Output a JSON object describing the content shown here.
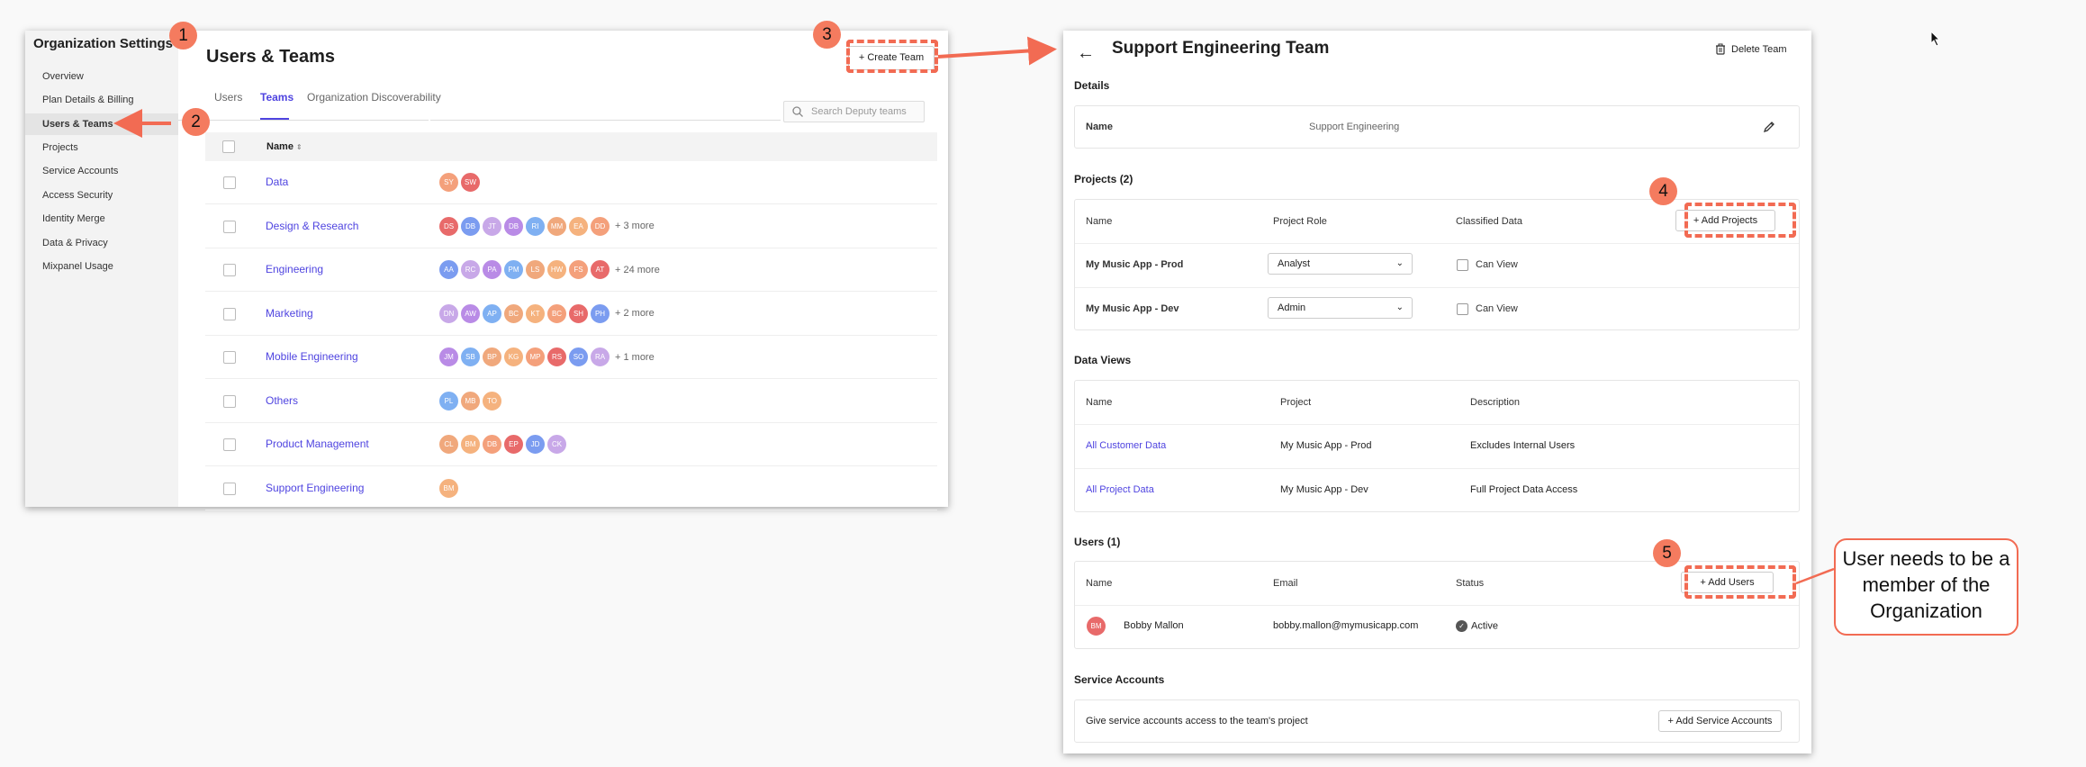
{
  "left_window": {
    "sidebar": {
      "title": "Organization Settings",
      "items": [
        {
          "label": "Overview"
        },
        {
          "label": "Plan Details & Billing"
        },
        {
          "label": "Users & Teams"
        },
        {
          "label": "Projects"
        },
        {
          "label": "Service Accounts"
        },
        {
          "label": "Access Security"
        },
        {
          "label": "Identity Merge"
        },
        {
          "label": "Data & Privacy"
        },
        {
          "label": "Mixpanel Usage"
        }
      ],
      "active_item": "Users & Teams"
    },
    "page_title": "Users & Teams",
    "tabs": [
      {
        "label": "Users"
      },
      {
        "label": "Teams"
      },
      {
        "label": "Organization Discoverability"
      }
    ],
    "active_tab": "Teams",
    "search_placeholder": "Search Deputy teams",
    "create_team_label": "+ Create Team",
    "table_header": "Name",
    "teams": [
      {
        "name": "Data",
        "members": [
          "SY",
          "SW"
        ],
        "more": ""
      },
      {
        "name": "Design & Research",
        "members": [
          "DS",
          "DB",
          "JT",
          "DB",
          "RI",
          "MM",
          "EA",
          "DD"
        ],
        "more": "+ 3 more"
      },
      {
        "name": "Engineering",
        "members": [
          "AA",
          "RC",
          "PA",
          "PM",
          "LS",
          "HW",
          "FS",
          "AT"
        ],
        "more": "+ 24 more"
      },
      {
        "name": "Marketing",
        "members": [
          "DN",
          "AW",
          "AP",
          "BC",
          "KT",
          "BC",
          "SH",
          "PH"
        ],
        "more": "+ 2 more"
      },
      {
        "name": "Mobile Engineering",
        "members": [
          "JM",
          "SB",
          "BP",
          "KG",
          "MP",
          "RS",
          "SO",
          "RA"
        ],
        "more": "+ 1 more"
      },
      {
        "name": "Others",
        "members": [
          "PL",
          "MB",
          "TO"
        ],
        "more": ""
      },
      {
        "name": "Product Management",
        "members": [
          "CL",
          "BM",
          "DB",
          "EP",
          "JD",
          "CK"
        ],
        "more": ""
      },
      {
        "name": "Support Engineering",
        "members": [
          "BM"
        ],
        "more": ""
      }
    ],
    "avatar_colors": [
      "#f4a07b",
      "#e86a6a",
      "#7b9cf0",
      "#c8a8e8",
      "#b98be6",
      "#7fb0f2",
      "#f0a87c",
      "#f5b27e"
    ]
  },
  "right_window": {
    "title": "Support Engineering Team",
    "delete_label": "Delete Team",
    "details": {
      "heading": "Details",
      "name_label": "Name",
      "name_value": "Support Engineering"
    },
    "projects": {
      "heading": "Projects (2)",
      "columns": [
        "Name",
        "Project Role",
        "Classified Data"
      ],
      "add_label": "+ Add Projects",
      "rows": [
        {
          "name": "My Music App - Prod",
          "role": "Analyst",
          "classified": "Can View"
        },
        {
          "name": "My Music App - Dev",
          "role": "Admin",
          "classified": "Can View"
        }
      ]
    },
    "data_views": {
      "heading": "Data Views",
      "columns": [
        "Name",
        "Project",
        "Description"
      ],
      "rows": [
        {
          "name": "All Customer Data",
          "project": "My Music App - Prod",
          "description": "Excludes Internal Users"
        },
        {
          "name": "All Project Data",
          "project": "My Music App - Dev",
          "description": "Full Project Data Access"
        }
      ]
    },
    "users": {
      "heading": "Users (1)",
      "columns": [
        "Name",
        "Email",
        "Status"
      ],
      "add_label": "+ Add Users",
      "rows": [
        {
          "initials": "BM",
          "name": "Bobby Mallon",
          "email": "bobby.mallon@mymusicapp.com",
          "status": "Active"
        }
      ]
    },
    "service_accounts": {
      "heading": "Service Accounts",
      "description": "Give service accounts access to the team's project",
      "add_label": "+ Add Service Accounts"
    }
  },
  "annotations": {
    "steps": [
      "1",
      "2",
      "3",
      "4",
      "5"
    ],
    "callout": "User needs to be a member of the Organization",
    "accent_color": "#f26b53"
  }
}
